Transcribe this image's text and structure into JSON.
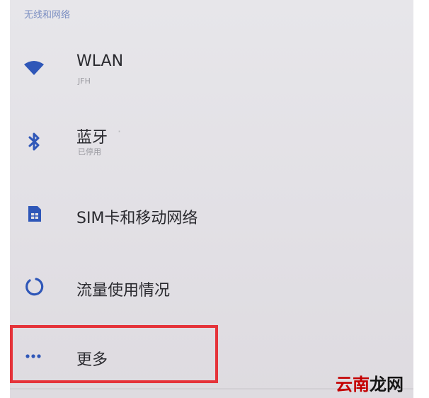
{
  "section": {
    "title": "无线和网络"
  },
  "items": [
    {
      "title": "WLAN",
      "subtitle": "JFH",
      "icon": "wifi-icon"
    },
    {
      "title": "蓝牙",
      "suffix": "·",
      "subtitle": "已停用",
      "icon": "bluetooth-icon"
    },
    {
      "title": "SIM卡和移动网络",
      "icon": "sim-card-icon"
    },
    {
      "title": "流量使用情况",
      "icon": "data-usage-icon"
    },
    {
      "title": "更多",
      "icon": "more-icon"
    }
  ],
  "watermark": {
    "part1": "云南",
    "part2": "龙网"
  },
  "colors": {
    "accent": "#2f57b8",
    "highlight": "#e5333a",
    "watermark_red": "#c40000"
  }
}
